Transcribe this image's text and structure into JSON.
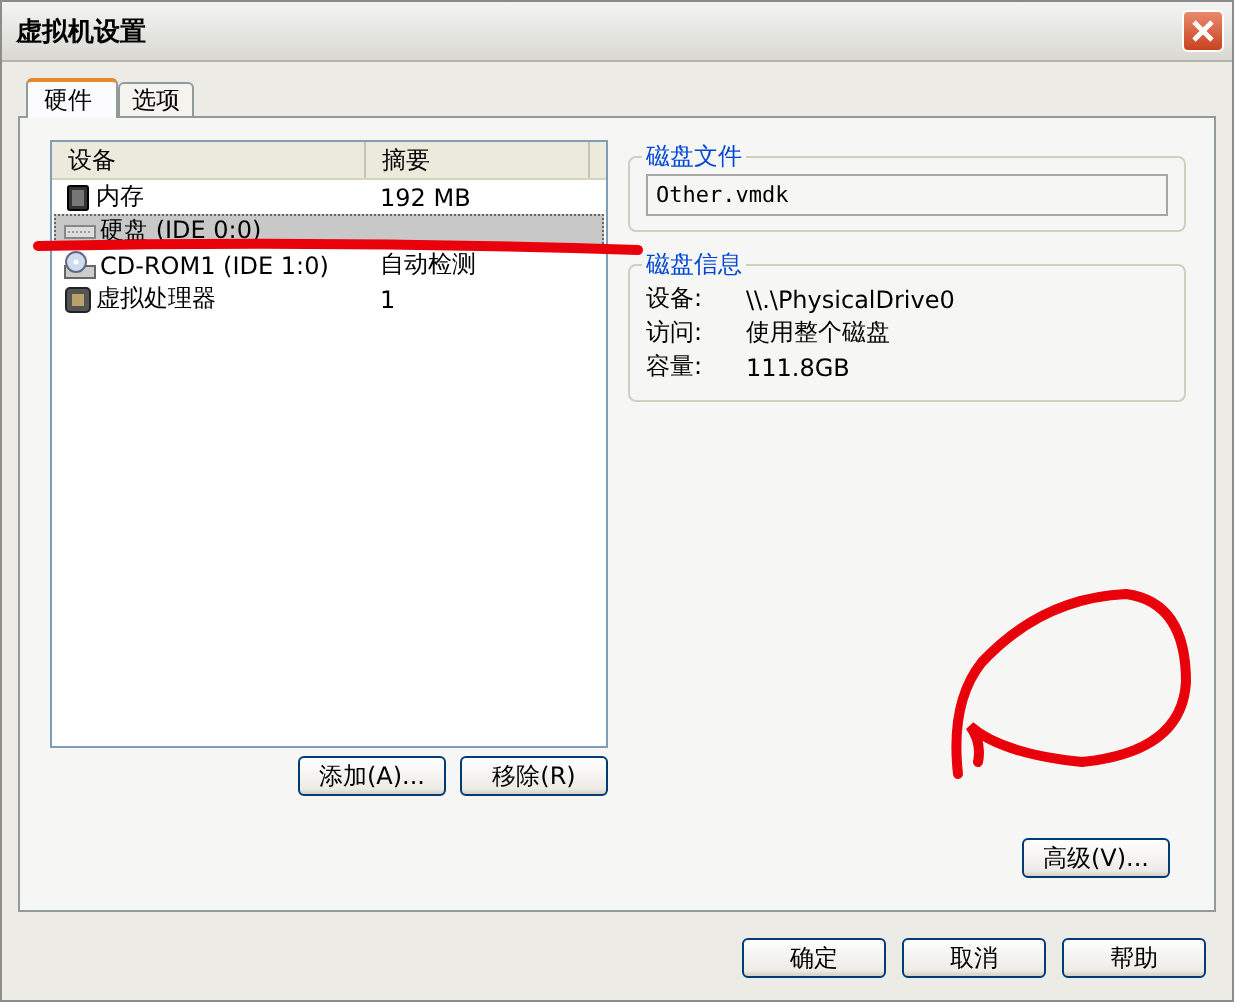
{
  "window": {
    "title": "虚拟机设置"
  },
  "tabs": [
    {
      "label": "硬件",
      "selected": true
    },
    {
      "label": "选项",
      "selected": false
    }
  ],
  "device_list": {
    "columns": [
      "设备",
      "摘要"
    ],
    "rows": [
      {
        "kind": "memory",
        "device": "内存",
        "summary": "192 MB",
        "selected": false
      },
      {
        "kind": "disk",
        "device": "硬盘 (IDE 0:0)",
        "summary": "",
        "selected": true
      },
      {
        "kind": "cdrom",
        "device": "CD-ROM1 (IDE 1:0)",
        "summary": "自动检测",
        "selected": false
      },
      {
        "kind": "cpu",
        "device": "虚拟处理器",
        "summary": "1",
        "selected": false
      }
    ]
  },
  "device_buttons": [
    "添加(A)...",
    "移除(R)"
  ],
  "disk_file": {
    "title": "磁盘文件",
    "value": "Other.vmdk"
  },
  "disk_info": {
    "title": "磁盘信息",
    "fields": [
      {
        "label": "设备:",
        "value": "\\\\.\\PhysicalDrive0"
      },
      {
        "label": "访问:",
        "value": "使用整个磁盘"
      },
      {
        "label": "容量:",
        "value": "111.8GB"
      }
    ]
  },
  "advanced_button": "高级(V)...",
  "dialog_buttons": [
    "确定",
    "取消",
    "帮助"
  ]
}
